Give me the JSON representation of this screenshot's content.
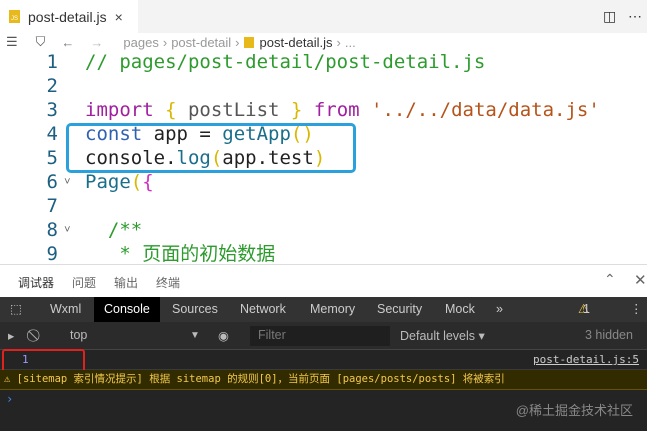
{
  "tab": {
    "title": "post-detail.js",
    "icon": "JS",
    "close": "×"
  },
  "breadcrumb": [
    "pages",
    "post-detail",
    "post-detail.js",
    "..."
  ],
  "code": [
    {
      "n": "1",
      "parts": [
        [
          "cm",
          "// pages/post-detail/post-detail.js"
        ]
      ]
    },
    {
      "n": "2",
      "parts": []
    },
    {
      "n": "3",
      "parts": [
        [
          "kw",
          "import "
        ],
        [
          "br",
          "{ "
        ],
        [
          "pl",
          "postList "
        ],
        [
          "br",
          "} "
        ],
        [
          "kw",
          "from "
        ],
        [
          "st",
          "'../../data/data.js'"
        ]
      ]
    },
    {
      "n": "4",
      "parts": [
        [
          "kb",
          "const "
        ],
        [
          "id",
          "app = "
        ],
        [
          "fn",
          "getApp"
        ],
        [
          "br",
          "()"
        ]
      ]
    },
    {
      "n": "5",
      "parts": [
        [
          "id",
          "console."
        ],
        [
          "fn",
          "log"
        ],
        [
          "br",
          "("
        ],
        [
          "id",
          "app.test"
        ],
        [
          "br",
          ")"
        ]
      ]
    },
    {
      "n": "6",
      "parts": [
        [
          "fn",
          "Page"
        ],
        [
          "br",
          "("
        ],
        [
          "pk",
          "{"
        ]
      ]
    },
    {
      "n": "7",
      "parts": []
    },
    {
      "n": "8",
      "parts": [
        [
          "cm",
          "  /**"
        ]
      ]
    },
    {
      "n": "9",
      "parts": [
        [
          "cm",
          "   * 页面的初始数据"
        ]
      ]
    }
  ],
  "panel_tabs": [
    "调试器",
    "问题",
    "输出",
    "终端"
  ],
  "devtools_tabs": [
    "Wxml",
    "Console",
    "Sources",
    "Network",
    "Memory",
    "Security",
    "Mock",
    "»"
  ],
  "warning_count": "1",
  "context": "top",
  "filter_placeholder": "Filter",
  "levels": "Default levels ▾",
  "hidden": "3 hidden",
  "console": {
    "value": "1",
    "source": "post-detail.js:5",
    "warning": "[sitemap 索引情况提示] 根据 sitemap 的规则[0]，当前页面 [pages/posts/posts] 将被索引",
    "prompt": "›"
  },
  "watermark": "@稀土掘金技术社区"
}
